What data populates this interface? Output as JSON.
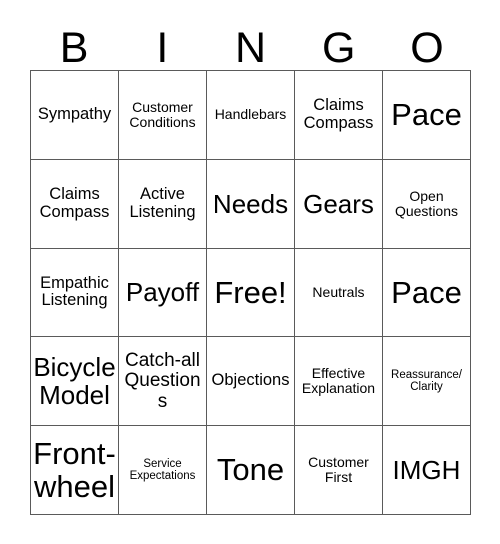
{
  "card": {
    "title_letters": [
      "B",
      "I",
      "N",
      "G",
      "O"
    ],
    "free_space_label": "Free!",
    "colors": {
      "grid_line": "#5a5a5a",
      "text": "#000000",
      "background": "#ffffff"
    },
    "rows": [
      [
        {
          "label": "Sympathy",
          "size": "m"
        },
        {
          "label": "Customer Conditions",
          "size": "s"
        },
        {
          "label": "Handlebars",
          "size": "s"
        },
        {
          "label": "Claims Compass",
          "size": "m"
        },
        {
          "label": "Pace",
          "size": "xxl"
        }
      ],
      [
        {
          "label": "Claims Compass",
          "size": "m"
        },
        {
          "label": "Active Listening",
          "size": "m"
        },
        {
          "label": "Needs",
          "size": "xl"
        },
        {
          "label": "Gears",
          "size": "xl"
        },
        {
          "label": "Open Questions",
          "size": "s"
        }
      ],
      [
        {
          "label": "Empathic Listening",
          "size": "m"
        },
        {
          "label": "Payoff",
          "size": "xl"
        },
        {
          "label": "Free!",
          "size": "xxl"
        },
        {
          "label": "Neutrals",
          "size": "s"
        },
        {
          "label": "Pace",
          "size": "xxl"
        }
      ],
      [
        {
          "label": "Bicycle Model",
          "size": "xl"
        },
        {
          "label": "Catch-all Questions",
          "size": "l"
        },
        {
          "label": "Objections",
          "size": "m"
        },
        {
          "label": "Effective Explanation",
          "size": "s"
        },
        {
          "label": "Reassurance/ Clarity",
          "size": "xs"
        }
      ],
      [
        {
          "label": "Front-wheel",
          "size": "xxl"
        },
        {
          "label": "Service Expectations",
          "size": "xs"
        },
        {
          "label": "Tone",
          "size": "xxl"
        },
        {
          "label": "Customer First",
          "size": "s"
        },
        {
          "label": "IMGH",
          "size": "xl"
        }
      ]
    ]
  }
}
